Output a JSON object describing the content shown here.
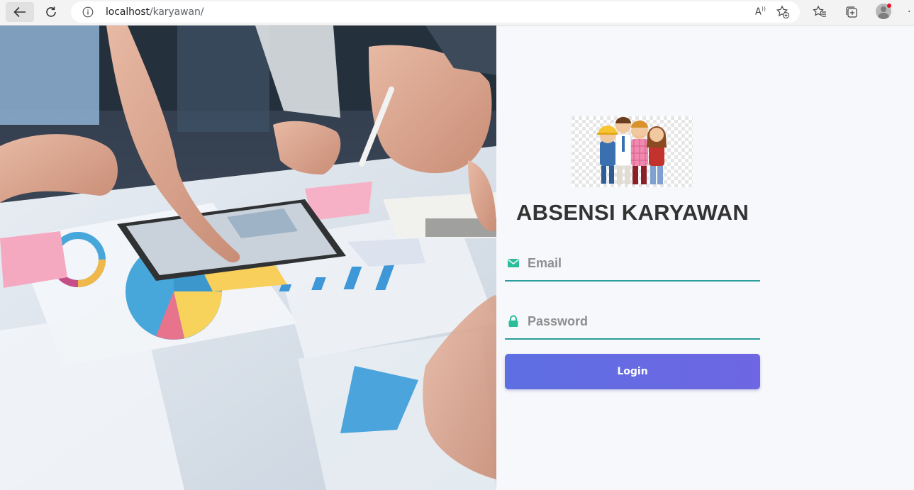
{
  "browser": {
    "url_host": "localhost",
    "url_path": "/karyawan/",
    "read_aloud_label": "A",
    "colors": {
      "chrome": "#f3f3f3",
      "address_bar": "#ffffff",
      "notification_dot": "#e81123"
    },
    "icons": [
      "back-arrow-icon",
      "reload-icon",
      "info-icon",
      "read-aloud-icon",
      "add-favorite-icon",
      "favorites-icon",
      "collections-icon",
      "profile-icon",
      "more-icon"
    ]
  },
  "login": {
    "title": "ABSENSI KARYAWAN",
    "email_placeholder": "Email",
    "password_placeholder": "Password",
    "login_label": "Login",
    "colors": {
      "panel_background": "#f7f8fc",
      "title": "#333333",
      "field_icon": "#2bbd9a",
      "field_underline": "#2a9d9d",
      "button_start": "#5e6fe3",
      "button_end": "#6e66e3",
      "button_text": "#ffffff"
    },
    "icons": {
      "email": "envelope-icon",
      "password": "lock-icon",
      "logo": "workers-group-logo"
    }
  },
  "hero": {
    "description_icon": "business-meeting-photo"
  }
}
